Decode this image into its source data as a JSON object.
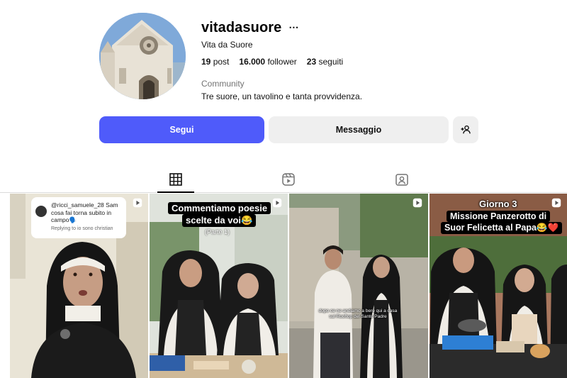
{
  "profile": {
    "username": "vitadasuore",
    "more_icon": "⋯",
    "full_name": "Vita da Suore",
    "stats": {
      "posts_count": "19",
      "posts_label": "post",
      "followers_count": "16.000",
      "followers_label": "follower",
      "following_count": "23",
      "following_label": "seguiti"
    },
    "category": "Community",
    "bio": "Tre suore, un tavolino e tanta provvidenza."
  },
  "actions": {
    "follow_label": "Segui",
    "message_label": "Messaggio",
    "suggest_icon": "add-person-icon"
  },
  "tabs": [
    {
      "name": "posts",
      "icon": "grid-icon",
      "active": true
    },
    {
      "name": "reels",
      "icon": "reels-icon",
      "active": false
    },
    {
      "name": "tagged",
      "icon": "tagged-icon",
      "active": false
    }
  ],
  "posts": [
    {
      "type": "reel",
      "reply_handle": "@ricci_samuele_28",
      "reply_text": "Sam cosa fai torna subito in campo🗣️",
      "reply_footer": "Replying to io sono christian"
    },
    {
      "type": "reel",
      "caption_line1": "Commentiamo poesie",
      "caption_line2": "scelte da voi😂",
      "caption_part": "(Parte 1)"
    },
    {
      "type": "reel",
      "subtitle_line1": "dopo ce ne andiamo a bere qui a casa",
      "subtitle_line2": "sul Rooftop del Santo Padre"
    },
    {
      "type": "reel",
      "day_label": "Giorno 3",
      "caption_line1": "Missione Panzerotto di",
      "caption_line2": "Suor Felicetta al Papa😂❤️"
    }
  ],
  "colors": {
    "follow_button": "#4f5bfa",
    "secondary_button": "#efefef",
    "muted_text": "#737373"
  }
}
